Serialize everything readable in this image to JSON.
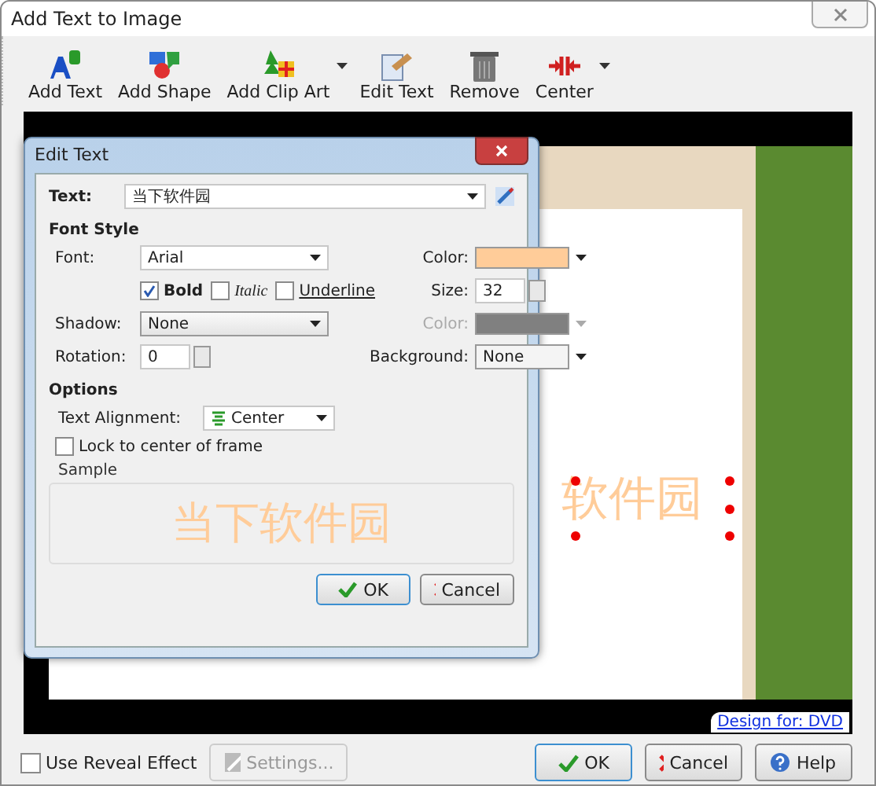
{
  "window": {
    "title": "Add Text to Image"
  },
  "toolbar": [
    {
      "label": "Add Text",
      "dropdown": false
    },
    {
      "label": "Add Shape",
      "dropdown": false
    },
    {
      "label": "Add Clip Art",
      "dropdown": true
    },
    {
      "label": "Edit Text",
      "dropdown": false
    },
    {
      "label": "Remove",
      "dropdown": false
    },
    {
      "label": "Center",
      "dropdown": true
    }
  ],
  "canvas": {
    "overlay_text": "软件园",
    "design_link": "Design for: DVD"
  },
  "dialog": {
    "title": "Edit Text",
    "text_label": "Text:",
    "text_value": "当下软件园",
    "font_style_heading": "Font Style",
    "font_label": "Font:",
    "font_value": "Arial",
    "color_label": "Color:",
    "color": "#ffcc99",
    "styles": [
      {
        "kind": "bold",
        "label": "Bold",
        "checked": true
      },
      {
        "kind": "italic",
        "label": "Italic",
        "checked": false
      },
      {
        "kind": "underline",
        "label": "Underline",
        "checked": false
      }
    ],
    "size_label": "Size:",
    "size_value": "32",
    "shadow_label": "Shadow:",
    "shadow_value": "None",
    "shadow_color_label": "Color:",
    "shadow_color_disabled": true,
    "rotation_label": "Rotation:",
    "rotation_value": "0",
    "background_label": "Background:",
    "background_value": "None",
    "options_heading": "Options",
    "alignment_label": "Text Alignment:",
    "alignment_value": "Center",
    "lock_label": "Lock to center of frame",
    "lock_checked": false,
    "sample_label": "Sample",
    "sample_text": "当下软件园",
    "ok": "OK",
    "cancel": "Cancel"
  },
  "footer": {
    "reveal_label": "Use Reveal Effect",
    "reveal_checked": false,
    "settings": "Settings...",
    "settings_disabled": true,
    "ok": "OK",
    "cancel": "Cancel",
    "help": "Help"
  }
}
